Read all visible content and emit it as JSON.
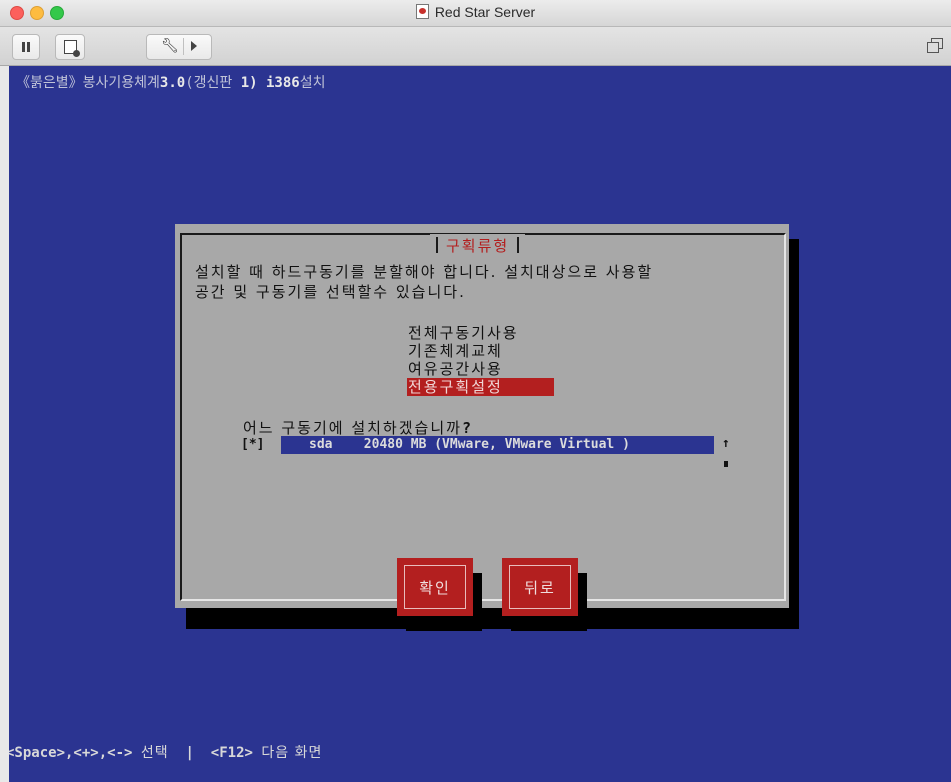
{
  "window": {
    "title": "Red Star Server"
  },
  "toolbar": {
    "pause_icon": "pause-icon",
    "snapshot_icon": "snapshot-icon",
    "settings_icon": "wrench-icon",
    "settings_arrow_icon": "chevron-right-icon",
    "restore_icon": "restore-window-icon"
  },
  "screen": {
    "header_prefix": "《붉은별》봉사기용체계",
    "header_version": "3.0",
    "header_update_label": "(갱신판 ",
    "header_update_num": "1)",
    "header_arch": " i386",
    "header_suffix": "설치",
    "dialog": {
      "title": "구획류형",
      "prompt_line1": "설치할 때 하드구동기를 분할해야 합니다. 설치대상으로 사용할",
      "prompt_line2": "공간 및 구동기를 선택할수 있습니다.",
      "options": [
        {
          "label": "전체구동기사용",
          "selected": false
        },
        {
          "label": "기존체계교체",
          "selected": false
        },
        {
          "label": "여유공간사용",
          "selected": false
        },
        {
          "label": "전용구획설정",
          "selected": true
        }
      ],
      "drive_question": "어느 구동기에 설치하겠습니까",
      "drive_question_mark": "?",
      "drive_checkbox": "[*]",
      "drive_entry": "sda    20480 MB (VMware, VMware Virtual )",
      "scroll_up": "↑",
      "buttons": {
        "ok": "확인",
        "back": "뒤로"
      }
    },
    "footer": {
      "keys": "<Space>,<+>,<-> ",
      "select": "선택",
      "separator": "  |  ",
      "f12": "<F12> ",
      "next": "다음 화면"
    }
  },
  "colors": {
    "screen_bg": "#2b3491",
    "dialog_bg": "#a8a8a8",
    "accent_red": "#b31f1f"
  }
}
